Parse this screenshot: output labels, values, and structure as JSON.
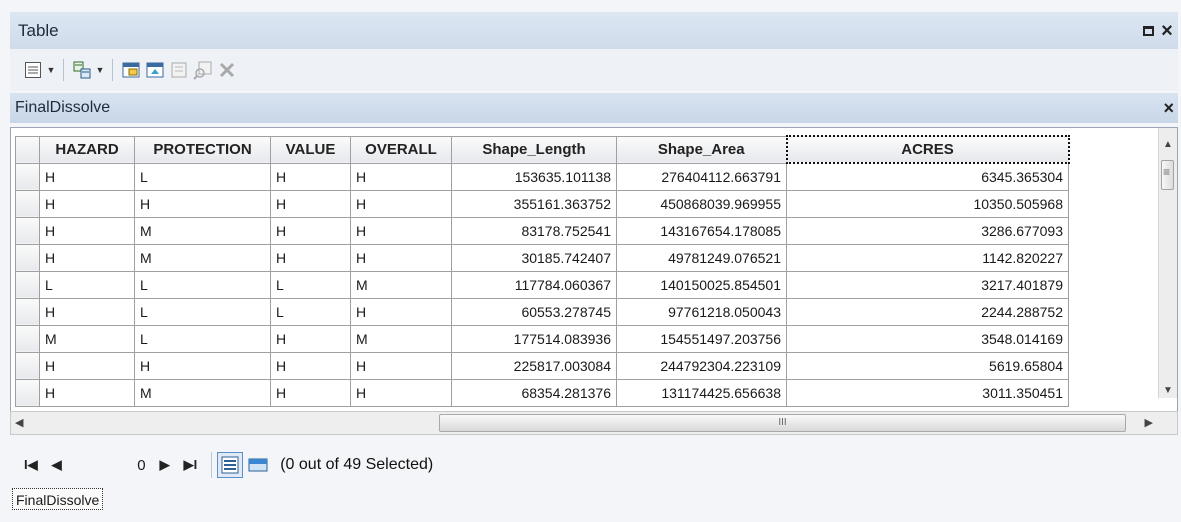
{
  "window": {
    "title": "Table"
  },
  "layer_tab": {
    "name": "FinalDissolve"
  },
  "table": {
    "columns": [
      "HAZARD",
      "PROTECTION",
      "VALUE",
      "OVERALL",
      "Shape_Length",
      "Shape_Area",
      "ACRES"
    ],
    "rows": [
      [
        "H",
        "L",
        "H",
        "H",
        "153635.101138",
        "276404112.663791",
        "6345.365304"
      ],
      [
        "H",
        "H",
        "H",
        "H",
        "355161.363752",
        "450868039.969955",
        "10350.505968"
      ],
      [
        "H",
        "M",
        "H",
        "H",
        "83178.752541",
        "143167654.178085",
        "3286.677093"
      ],
      [
        "H",
        "M",
        "H",
        "H",
        "30185.742407",
        "49781249.076521",
        "1142.820227"
      ],
      [
        "L",
        "L",
        "L",
        "M",
        "117784.060367",
        "140150025.854501",
        "3217.401879"
      ],
      [
        "H",
        "L",
        "L",
        "H",
        "60553.278745",
        "97761218.050043",
        "2244.288752"
      ],
      [
        "M",
        "L",
        "H",
        "M",
        "177514.083936",
        "154551497.203756",
        "3548.014169"
      ],
      [
        "H",
        "H",
        "H",
        "H",
        "225817.003084",
        "244792304.223109",
        "5619.65804"
      ],
      [
        "H",
        "M",
        "H",
        "H",
        "68354.281376",
        "131174425.656638",
        "3011.350451"
      ]
    ]
  },
  "navigation": {
    "current_record": "0",
    "status": "(0 out of 49 Selected)"
  },
  "hscroll": {
    "grip": "III"
  },
  "bottom_tab": {
    "name": "FinalDissolve"
  }
}
